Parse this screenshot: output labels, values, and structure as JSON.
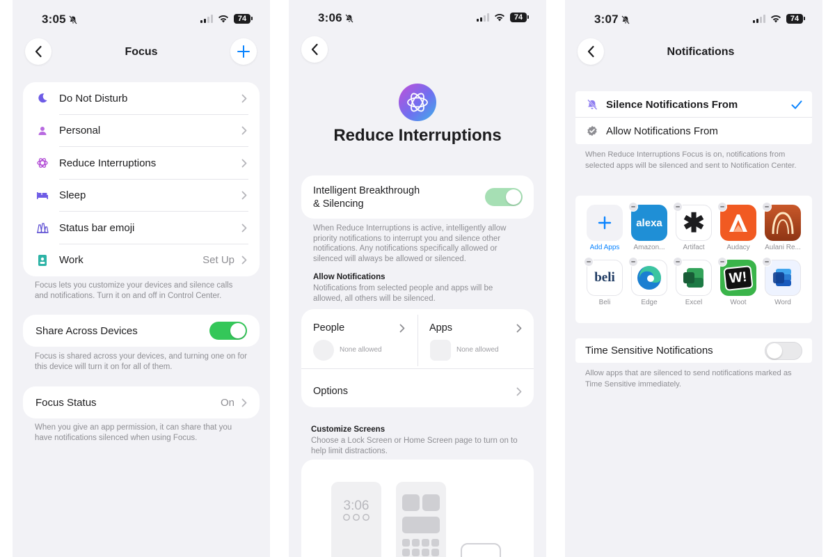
{
  "colors": {
    "accent": "#0a84ff",
    "toggle_on": "#34c759",
    "background": "#f2f2f6"
  },
  "screen1": {
    "status": {
      "time": "3:05",
      "battery": "74"
    },
    "nav": {
      "title": "Focus",
      "back_icon": "chevron-left-icon",
      "add_icon": "plus-icon"
    },
    "focus_modes": [
      {
        "label": "Do Not Disturb",
        "value": "",
        "icon": "moon-icon"
      },
      {
        "label": "Personal",
        "value": "",
        "icon": "person-icon"
      },
      {
        "label": "Reduce Interruptions",
        "value": "",
        "icon": "reduce-interruptions-icon"
      },
      {
        "label": "Sleep",
        "value": "",
        "icon": "bed-icon"
      },
      {
        "label": "Status bar emoji",
        "value": "",
        "icon": "emoji-icon"
      },
      {
        "label": "Work",
        "value": "Set Up",
        "icon": "badge-icon"
      }
    ],
    "focus_note": "Focus lets you customize your devices and silence calls and notifications. Turn it on and off in Control Center.",
    "share": {
      "label": "Share Across Devices",
      "on": true
    },
    "share_note": "Focus is shared across your devices, and turning one on for this device will turn it on for all of them.",
    "focus_status": {
      "label": "Focus Status",
      "value": "On"
    },
    "status_note": "When you give an app permission, it can share that you have notifications silenced when using Focus."
  },
  "screen2": {
    "status": {
      "time": "3:06",
      "battery": "74"
    },
    "title": "Reduce Interruptions",
    "breakthrough": {
      "label_line1": "Intelligent Breakthrough",
      "label_line2": "& Silencing",
      "on": true
    },
    "breakthrough_note": "When Reduce Interruptions is active, intelligently allow priority notifications to interrupt you and silence other notifications. Any notifications specifically allowed or silenced will always be allowed or silenced.",
    "allow_heading": "Allow Notifications",
    "allow_note": "Notifications from selected people and apps will be allowed, all others will be silenced.",
    "people": {
      "label": "People",
      "sub": "None allowed"
    },
    "apps": {
      "label": "Apps",
      "sub": "None allowed"
    },
    "options_label": "Options",
    "customize_heading": "Customize Screens",
    "customize_note": "Choose a Lock Screen or Home Screen page to turn on to help limit distractions.",
    "lock_time": "3:06"
  },
  "screen3": {
    "status": {
      "time": "3:07",
      "battery": "74"
    },
    "nav": {
      "title": "Notifications"
    },
    "silence_label": "Silence Notifications From",
    "allow_label": "Allow Notifications From",
    "mode_note": "When Reduce Interruptions Focus is on, notifications from selected apps will be silenced and sent to Notification Center.",
    "add_apps_label": "Add Apps",
    "apps": [
      {
        "name": "Amazon...",
        "glyph": "alexa",
        "bg": "#1f8fd6",
        "fg": "#ffffff",
        "icon": "alexa-icon"
      },
      {
        "name": "Artifact",
        "glyph": "✱",
        "bg": "#ffffff",
        "fg": "#1c1c1e",
        "icon": "artifact-icon"
      },
      {
        "name": "Audacy",
        "glyph": "A",
        "bg": "#f15a22",
        "fg": "#ffffff",
        "icon": "audacy-icon"
      },
      {
        "name": "Aulani Re...",
        "glyph": "∩",
        "bg": "#b9471f",
        "fg": "#ffe7c2",
        "icon": "aulani-icon"
      },
      {
        "name": "Beli",
        "glyph": "beli",
        "bg": "#ffffff",
        "fg": "#1f3b63",
        "icon": "beli-icon"
      },
      {
        "name": "Edge",
        "glyph": "e",
        "bg": "#ffffff",
        "fg": "#1b7fd1",
        "icon": "edge-icon"
      },
      {
        "name": "Excel",
        "glyph": "▰",
        "bg": "#ffffff",
        "fg": "#1d7a45",
        "icon": "excel-icon"
      },
      {
        "name": "Woot",
        "glyph": "W!",
        "bg": "#3ab44a",
        "fg": "#111111",
        "icon": "woot-icon"
      },
      {
        "name": "Word",
        "glyph": "▬",
        "bg": "#e8f0ff",
        "fg": "#2b66e0",
        "icon": "word-icon"
      }
    ],
    "time_sensitive": {
      "label": "Time Sensitive Notifications",
      "on": false
    },
    "time_sensitive_note": "Allow apps that are silenced to send notifications marked as Time Sensitive immediately."
  }
}
